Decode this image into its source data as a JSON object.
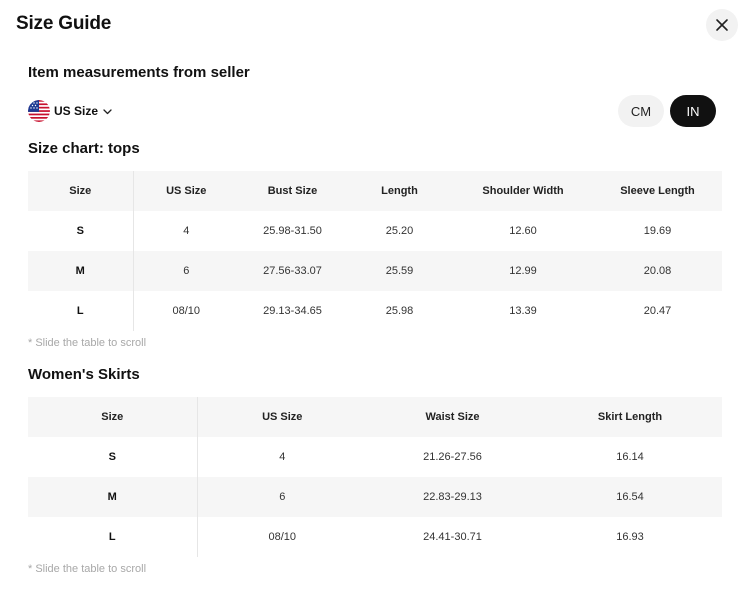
{
  "dialog": {
    "title": "Size Guide"
  },
  "subtitle": "Item measurements from seller",
  "region": {
    "label": "US Size"
  },
  "units": {
    "cm": "CM",
    "in": "IN",
    "selected": "IN"
  },
  "tops": {
    "title": "Size chart: tops",
    "headers": [
      "Size",
      "US Size",
      "Bust Size",
      "Length",
      "Shoulder Width",
      "Sleeve Length"
    ],
    "rows": [
      [
        "S",
        "4",
        "25.98-31.50",
        "25.20",
        "12.60",
        "19.69"
      ],
      [
        "M",
        "6",
        "27.56-33.07",
        "25.59",
        "12.99",
        "20.08"
      ],
      [
        "L",
        "08/10",
        "29.13-34.65",
        "25.98",
        "13.39",
        "20.47"
      ]
    ],
    "hint": "* Slide the table to scroll"
  },
  "skirts": {
    "title": "Women's Skirts",
    "headers": [
      "Size",
      "US Size",
      "Waist Size",
      "Skirt Length"
    ],
    "rows": [
      [
        "S",
        "4",
        "21.26-27.56",
        "16.14"
      ],
      [
        "M",
        "6",
        "22.83-29.13",
        "16.54"
      ],
      [
        "L",
        "08/10",
        "24.41-30.71",
        "16.93"
      ]
    ],
    "hint": "* Slide the table to scroll"
  },
  "icons": {
    "close": "close-icon",
    "flag": "us-flag-icon",
    "dropdown": "chevron-down-icon"
  }
}
